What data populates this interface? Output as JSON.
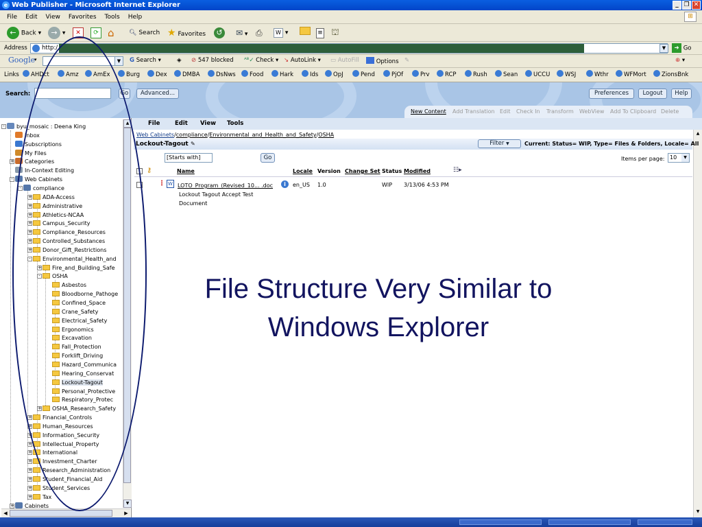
{
  "window": {
    "title": "Web Publisher - Microsoft Internet Explorer"
  },
  "menu": [
    "File",
    "Edit",
    "View",
    "Favorites",
    "Tools",
    "Help"
  ],
  "toolbar": {
    "back": "Back",
    "search": "Search",
    "favorites": "Favorites"
  },
  "address": {
    "label": "Address",
    "value": "http:/",
    "go": "Go"
  },
  "google": {
    "brand": "Google",
    "search": "Search",
    "blocked": "547 blocked",
    "check": "Check",
    "autolink": "AutoLink",
    "autofill": "AutoFill",
    "options": "Options"
  },
  "links": {
    "label": "Links",
    "items": [
      "AHDct",
      "Amz",
      "AmEx",
      "Burg",
      "Dex",
      "DMBA",
      "DsNws",
      "Food",
      "Hark",
      "Ids",
      "OpJ",
      "Pend",
      "PjOf",
      "Prv",
      "RCP",
      "Rush",
      "Sean",
      "UCCU",
      "WSJ",
      "Wthr",
      "WFMort",
      "ZionsBnk"
    ]
  },
  "header": {
    "search_label": "Search:",
    "go": "Go",
    "advanced": "Advanced...",
    "preferences": "Preferences",
    "logout": "Logout",
    "help": "Help",
    "actions": [
      "New Content",
      "Add Translation",
      "Edit",
      "Check In",
      "Transform",
      "WebView",
      "Add To Clipboard",
      "Delete"
    ]
  },
  "doc_menu": [
    "File",
    "Edit",
    "View",
    "Tools"
  ],
  "tree": {
    "root": "byu_mosaic : Deena King",
    "top": [
      "Inbox",
      "Subscriptions",
      "My Files",
      "Categories",
      "In-Context Editing",
      "Web Cabinets"
    ],
    "compliance": "compliance",
    "compliance_children_a": [
      "ADA-Access",
      "Administrative",
      "Athletics-NCAA",
      "Campus_Security",
      "Compliance_Resources",
      "Controlled_Substances",
      "Donor_Gift_Restrictions",
      "Environmental_Health_and"
    ],
    "env_children": [
      "Fire_and_Building_Safe",
      "OSHA"
    ],
    "osha_children": [
      "Asbestos",
      "Bloodborne_Pathoge",
      "Confined_Space",
      "Crane_Safety",
      "Electrical_Safety",
      "Ergonomics",
      "Excavation",
      "Fall_Protection",
      "Forklift_Driving",
      "Hazard_Communica",
      "Hearing_Conservat",
      "Lockout-Tagout",
      "Personal_Protective",
      "Respiratory_Protec"
    ],
    "env_after": "OSHA_Research_Safety",
    "compliance_children_b": [
      "Financial_Controls",
      "Human_Resources",
      "Information_Security",
      "Intellectual_Property",
      "International",
      "Investment_Charter",
      "Research_Administration",
      "Student_Financial_Aid",
      "Student_Services",
      "Tax"
    ],
    "cabinets": "Cabinets"
  },
  "breadcrumb": [
    "Web Cabinets",
    "compliance",
    "Environmental_and_Health_and_Safety",
    "OSHA"
  ],
  "folder_title": "Lockout-Tagout",
  "filter": {
    "button": "Filter",
    "current": "Current: Status= WIP, Type= Files & Folders, Locale= All",
    "starts_with": "[Starts with]",
    "go": "Go",
    "items_per_page_label": "Items per page:",
    "items_per_page": "10"
  },
  "table": {
    "headers": [
      "Name",
      "Locale",
      "Version",
      "Change Set",
      "Status",
      "Modified"
    ],
    "rows": [
      {
        "name": "LOTO_Program_(Revised_10... .doc",
        "desc1": "Lockout Tagout Accept Test",
        "desc2": "Document",
        "locale": "en_US",
        "version": "1.0",
        "status": "WIP",
        "modified": "3/13/06 4:53 PM"
      }
    ]
  },
  "slide": {
    "line1": "File Structure Very Similar to",
    "line2": "Windows Explorer"
  }
}
